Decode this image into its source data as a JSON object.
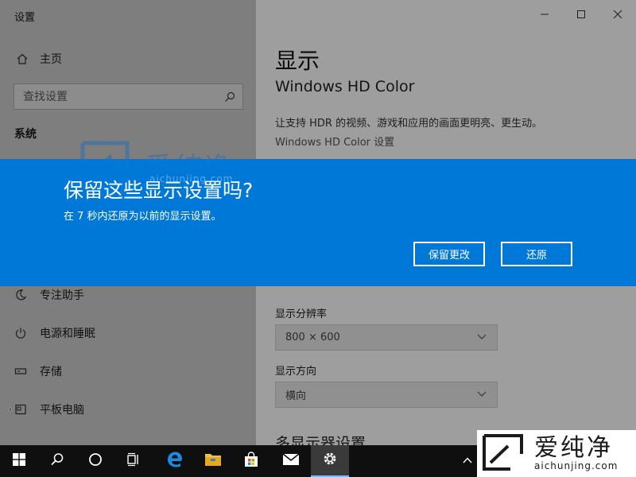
{
  "window": {
    "title": "设置"
  },
  "sidebar": {
    "home_label": "主页",
    "search_placeholder": "查找设置",
    "section_label": "系统",
    "items": [
      {
        "label": "专注助手",
        "icon": "moon-icon"
      },
      {
        "label": "电源和睡眠",
        "icon": "power-icon"
      },
      {
        "label": "存储",
        "icon": "storage-icon"
      },
      {
        "label": "平板电脑",
        "icon": "tablet-icon"
      }
    ]
  },
  "main": {
    "title": "显示",
    "subtitle": "Windows HD Color",
    "description": "让支持 HDR 的视频、游戏和应用的画面更明亮、更生动。",
    "hd_color_link": "Windows HD Color 设置",
    "resolution_label": "显示分辨率",
    "resolution_value": "800 × 600",
    "orientation_label": "显示方向",
    "orientation_value": "横向",
    "multi_display_heading": "多显示器设置"
  },
  "dialog": {
    "title": "保留这些显示设置吗?",
    "message": "在  7 秒内还原为以前的显示设置。",
    "keep_label": "保留更改",
    "revert_label": "还原"
  },
  "watermark": {
    "text": "爱纯净",
    "sub": "aichunjing.com"
  },
  "colors": {
    "accent": "#0078d7",
    "taskbar": "#0f0f0f",
    "edge": "#1a8be0",
    "folder": "#f0c14b"
  }
}
